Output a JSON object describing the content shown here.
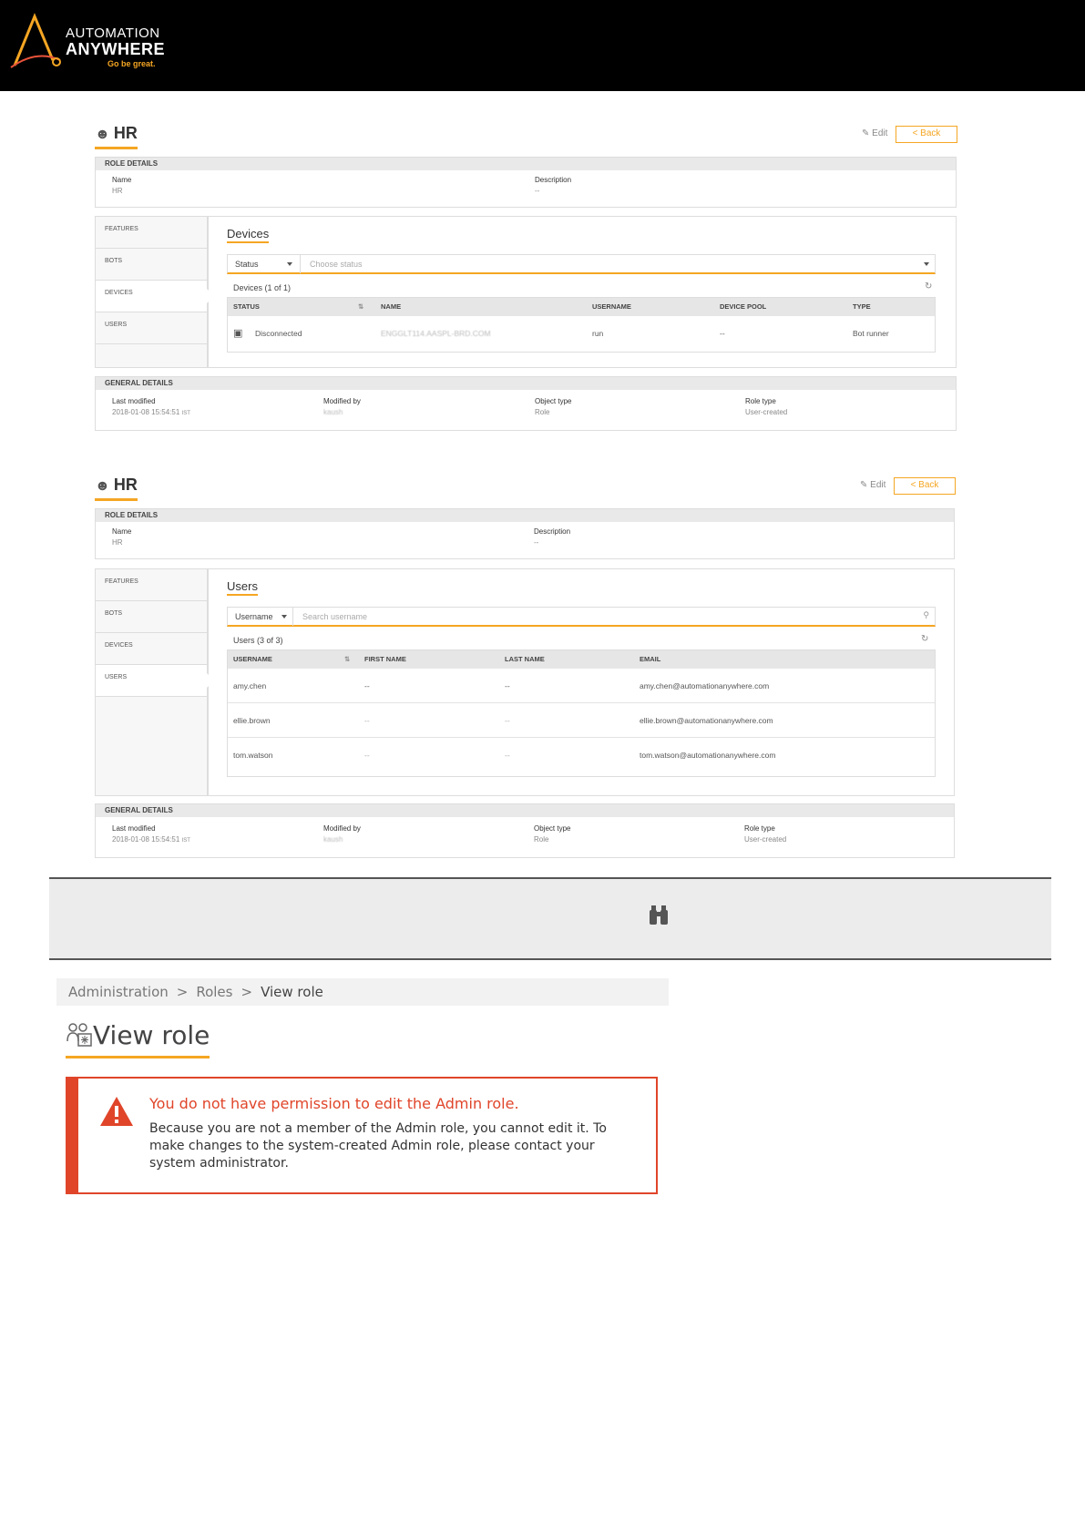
{
  "brand": {
    "line1": "AUTOMATION",
    "line2": "ANYWHERE",
    "tagline": "Go be great.",
    "accent": "#f5a623"
  },
  "devices_view": {
    "role_name": "HR",
    "edit_label": "Edit",
    "back_label": "< Back",
    "role_details": {
      "header": "ROLE DETAILS",
      "name_label": "Name",
      "name_value": "HR",
      "description_label": "Description",
      "description_value": "--"
    },
    "nav": [
      "FEATURES",
      "BOTS",
      "DEVICES",
      "USERS"
    ],
    "active_nav": "DEVICES",
    "section_title": "Devices",
    "filter": {
      "select": "Status",
      "placeholder": "Choose status"
    },
    "count": "Devices (1 of 1)",
    "columns": [
      "STATUS",
      "NAME",
      "USERNAME",
      "DEVICE POOL",
      "TYPE"
    ],
    "rows": [
      {
        "status": "Disconnected",
        "name": "ENGGLT114.AASPL-BRD.COM",
        "username": "run",
        "device_pool": "--",
        "type": "Bot runner"
      }
    ],
    "general": {
      "header": "GENERAL DETAILS",
      "last_modified_label": "Last modified",
      "last_modified_value": "2018-01-08 15:54:51",
      "tz": "IST",
      "modified_by_label": "Modified by",
      "modified_by_value": "kaush",
      "object_type_label": "Object type",
      "object_type_value": "Role",
      "role_type_label": "Role type",
      "role_type_value": "User-created"
    }
  },
  "users_view": {
    "role_name": "HR",
    "edit_label": "Edit",
    "back_label": "< Back",
    "role_details": {
      "header": "ROLE DETAILS",
      "name_label": "Name",
      "name_value": "HR",
      "description_label": "Description",
      "description_value": "--"
    },
    "nav": [
      "FEATURES",
      "BOTS",
      "DEVICES",
      "USERS"
    ],
    "active_nav": "USERS",
    "section_title": "Users",
    "filter": {
      "select": "Username",
      "placeholder": "Search username"
    },
    "count": "Users (3 of 3)",
    "columns": [
      "USERNAME",
      "FIRST NAME",
      "LAST NAME",
      "EMAIL"
    ],
    "rows": [
      {
        "username": "amy.chen",
        "first_name": "--",
        "last_name": "--",
        "email": "amy.chen@automationanywhere.com"
      },
      {
        "username": "ellie.brown",
        "first_name": "--",
        "last_name": "--",
        "email": "ellie.brown@automationanywhere.com"
      },
      {
        "username": "tom.watson",
        "first_name": "--",
        "last_name": "--",
        "email": "tom.watson@automationanywhere.com"
      }
    ],
    "general": {
      "header": "GENERAL DETAILS",
      "last_modified_label": "Last modified",
      "last_modified_value": "2018-01-08 15:54:51",
      "tz": "IST",
      "modified_by_label": "Modified by",
      "modified_by_value": "kaush",
      "object_type_label": "Object type",
      "object_type_value": "Role",
      "role_type_label": "Role type",
      "role_type_value": "User-created"
    }
  },
  "breadcrumb": [
    "Administration",
    "Roles",
    "View role"
  ],
  "page_title": "View role",
  "alert": {
    "title": "You do not have permission to edit the Admin role.",
    "body": "Because you are not a member of the Admin role, you cannot edit it. To make changes to the system-created Admin role, please contact your system administrator.",
    "color": "#e0452a"
  }
}
